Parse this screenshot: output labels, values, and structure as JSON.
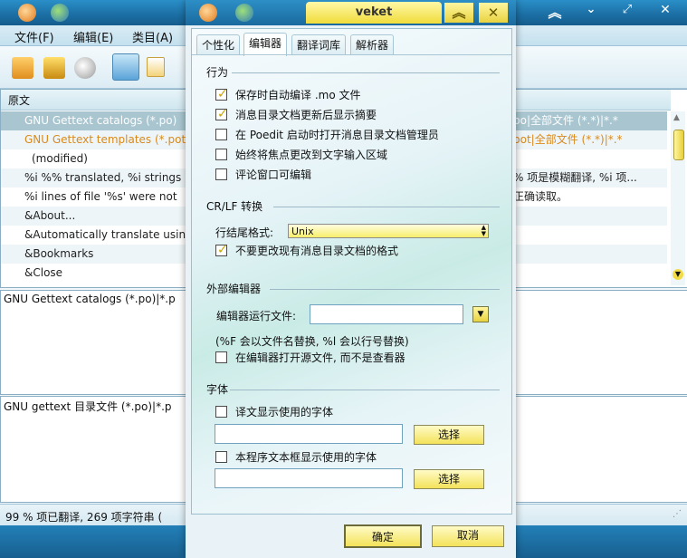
{
  "main": {
    "menu": [
      "文件(F)",
      "编辑(E)",
      "类目(A)"
    ],
    "list_header": "原文",
    "rows": [
      {
        "left": "GNU Gettext catalogs (*.po)",
        "right": "po|全部文件 (*.*)|*.*",
        "style": "selected"
      },
      {
        "left": "GNU Gettext templates (*.pot",
        "right": "pot|全部文件 (*.*)|*.*",
        "style": "orange"
      },
      {
        "left": "(modified)",
        "right": "",
        "style": "plain"
      },
      {
        "left": "%i %% translated, %i strings (%",
        "right": "% 项是模糊翻译, %i 项...",
        "style": "plain"
      },
      {
        "left": "%i lines of file '%s' were not",
        "right": "正确读取。",
        "style": "plain"
      },
      {
        "left": "&About...",
        "right": "",
        "style": "plain"
      },
      {
        "left": "&Automatically translate using",
        "right": "",
        "style": "plain"
      },
      {
        "left": "&Bookmarks",
        "right": "",
        "style": "plain"
      },
      {
        "left": "&Close",
        "right": "",
        "style": "plain"
      }
    ],
    "source_pane_text": "GNU Gettext catalogs (*.po)|*.p",
    "translation_pane_text": "GNU gettext 目录文件 (*.po)|*.p",
    "status_text": "99 % 项已翻译, 269 项字符串 ("
  },
  "dialog": {
    "title": "veket",
    "tabs": [
      "个性化",
      "编辑器",
      "翻译词库",
      "解析器"
    ],
    "behavior": {
      "header": "行为",
      "options": [
        {
          "label": "保存时自动编译 .mo 文件",
          "checked": true
        },
        {
          "label": "消息目录文档更新后显示摘要",
          "checked": true
        },
        {
          "label": "在 Poedit 启动时打开消息目录文档管理员",
          "checked": false
        },
        {
          "label": "始终将焦点更改到文字输入区域",
          "checked": false
        },
        {
          "label": "评论窗口可编辑",
          "checked": false
        }
      ]
    },
    "crlf": {
      "header": "CR/LF 转换",
      "eol_label": "行结尾格式:",
      "eol_value": "Unix",
      "keep_label": "不要更改现有消息目录文档的格式",
      "keep_checked": true
    },
    "external_editor": {
      "header": "外部编辑器",
      "run_label": "编辑器运行文件:",
      "run_value": "",
      "hint": "(%F 会以文件名替换, %l 会以行号替换)",
      "open_label": "在编辑器打开源文件, 而不是查看器",
      "open_checked": false
    },
    "fonts": {
      "header": "字体",
      "trans_label": "译文显示使用的字体",
      "trans_checked": false,
      "trans_value": "",
      "app_label": "本程序文本框显示使用的字体",
      "app_checked": false,
      "app_value": "",
      "choose_label": "选择"
    },
    "ok_label": "确定",
    "cancel_label": "取消"
  },
  "colors": {
    "titlebar": "#1b6ea3",
    "selected_row": "#a9c6d0",
    "orange_text": "#d98a1c",
    "yellow_button": "#f3e25a"
  }
}
